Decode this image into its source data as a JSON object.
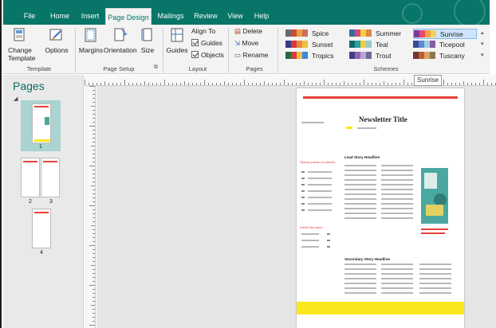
{
  "tabs": [
    "File",
    "Home",
    "Insert",
    "Page Design",
    "Mailings",
    "Review",
    "View",
    "Help"
  ],
  "active_tab": "Page Design",
  "ribbon": {
    "template": {
      "change_label": "Change\nTemplate",
      "options_label": "Options",
      "group_label": "Template"
    },
    "page_setup": {
      "margins_label": "Margins",
      "orientation_label": "Orientation",
      "size_label": "Size",
      "group_label": "Page Setup"
    },
    "layout": {
      "guides_label": "Guides",
      "align_to_label": "Align To",
      "guides_check_label": "Guides",
      "objects_check_label": "Objects",
      "group_label": "Layout"
    },
    "pages": {
      "delete_label": "Delete",
      "move_label": "Move",
      "rename_label": "Rename",
      "group_label": "Pages"
    },
    "schemes": {
      "group_label": "Schemes",
      "items": [
        {
          "name": "Spice",
          "colors": [
            "#6a6a6a",
            "#c84b3a",
            "#e8a23a",
            "#d06c5e"
          ]
        },
        {
          "name": "Summer",
          "colors": [
            "#3a6a9a",
            "#d84a7a",
            "#f5d040",
            "#e08840"
          ]
        },
        {
          "name": "Sunrise",
          "colors": [
            "#7a3a9a",
            "#e84a6a",
            "#f5a040",
            "#f0d060"
          ]
        },
        {
          "name": "Sunset",
          "colors": [
            "#3a3a8a",
            "#d83a3a",
            "#e8883a",
            "#f0c040"
          ]
        },
        {
          "name": "Teal",
          "colors": [
            "#0a6a6a",
            "#2aa0a0",
            "#f0d040",
            "#9acaca"
          ]
        },
        {
          "name": "Ticepool",
          "colors": [
            "#3a4a9a",
            "#5a8ad8",
            "#a0d0e0",
            "#8a5aa0"
          ]
        },
        {
          "name": "Tropics",
          "colors": [
            "#2a6a3a",
            "#d83a3a",
            "#f0c040",
            "#3a8ad8"
          ]
        },
        {
          "name": "Trout",
          "colors": [
            "#4a3a8a",
            "#8a6ab0",
            "#c0a0d0",
            "#6a6a9a"
          ]
        },
        {
          "name": "Tuscany",
          "colors": [
            "#6a3a2a",
            "#c05a3a",
            "#e0a060",
            "#8a7a4a"
          ]
        }
      ],
      "selected": "Sunrise"
    }
  },
  "pages_panel": {
    "title": "Pages",
    "labels": [
      "1",
      "2",
      "3",
      "4"
    ]
  },
  "ruler": {
    "tooltip": "Sunrise"
  },
  "document": {
    "title": "Newsletter Title",
    "lead_heading": "Lead Story Headline",
    "secondary_heading": "Secondary Story Headline",
    "sidebar_heading": "Special points of interest:",
    "inside_heading": "Inside this issue:"
  },
  "colors": {
    "accent": "#077568",
    "doc_yellow": "#f8e81c",
    "doc_red": "#e8403a"
  }
}
